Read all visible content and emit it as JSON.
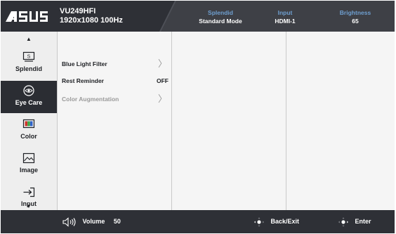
{
  "header": {
    "brand": "/ISUS",
    "model": "VU249HFI",
    "resolution": "1920x1080 100Hz",
    "stats": [
      {
        "label": "Splendid",
        "value": "Standard Mode"
      },
      {
        "label": "Input",
        "value": "HDMI-1"
      },
      {
        "label": "Brightness",
        "value": "65"
      }
    ]
  },
  "sidebar": {
    "up_icon": "triangle-up-icon",
    "down_icon": "triangle-down-icon",
    "items": [
      {
        "label": "Splendid",
        "icon": "splendid-icon",
        "active": false
      },
      {
        "label": "Eye Care",
        "icon": "eye-icon",
        "active": true
      },
      {
        "label": "Color",
        "icon": "color-bars-icon",
        "active": false
      },
      {
        "label": "Image",
        "icon": "image-icon",
        "active": false
      },
      {
        "label": "Input",
        "icon": "input-arrow-icon",
        "active": false
      }
    ]
  },
  "menu": {
    "items": [
      {
        "label": "Blue Light Filter",
        "value": "",
        "has_submenu": true,
        "enabled": true
      },
      {
        "label": "Rest Reminder",
        "value": "OFF",
        "has_submenu": false,
        "enabled": true
      },
      {
        "label": "Color Augmentation",
        "value": "",
        "has_submenu": true,
        "enabled": false
      }
    ]
  },
  "footer": {
    "volume_label": "Volume",
    "volume_value": "50",
    "back_label": "Back/Exit",
    "enter_label": "Enter"
  },
  "colors": {
    "header_bg": "#2e3036",
    "accent_label": "#6f9fd0",
    "active_bg": "#2b2d33",
    "disabled_text": "#9a9a9a"
  }
}
